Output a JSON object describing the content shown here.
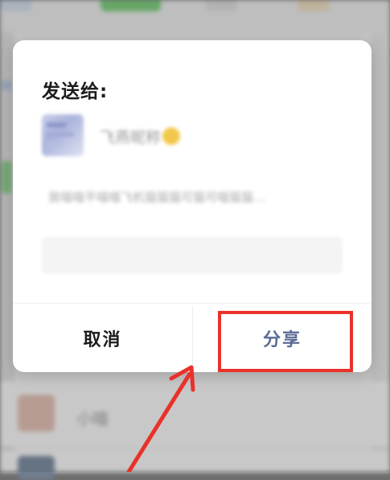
{
  "dialog": {
    "title": "发送给:",
    "recipient": {
      "name": "飞燕昵称"
    },
    "message_preview": "我喵喵平喵喵飞机猫猫猫可猫可喵猫猫…",
    "comment_placeholder": "",
    "buttons": {
      "cancel": "取消",
      "share": "分享"
    }
  },
  "background": {
    "row_label": "小喵"
  },
  "colors": {
    "share_text": "#5b6a94",
    "annotation": "#e8322a",
    "emoji": "#f2c84b"
  },
  "icons": {
    "recipient_emoji": "smile-emoji-icon",
    "annotation_arrow": "arrow-up-right-icon"
  }
}
